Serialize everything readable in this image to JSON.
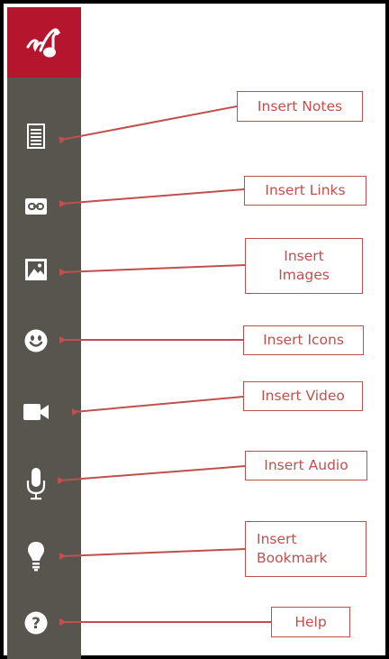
{
  "app": {
    "logo_icon": "music-notes-logo-icon",
    "sidebar_color": "#57554d",
    "logo_color": "#b5162d",
    "callout_color": "#c0504d"
  },
  "tools": [
    {
      "name": "notes",
      "icon": "document-lines-icon",
      "callout": "Insert Notes"
    },
    {
      "name": "links",
      "icon": "chain-link-icon",
      "callout": "Insert Links"
    },
    {
      "name": "images",
      "icon": "picture-icon",
      "callout": "Insert\nImages"
    },
    {
      "name": "icons",
      "icon": "smiley-face-icon",
      "callout": "Insert Icons"
    },
    {
      "name": "video",
      "icon": "video-camera-icon",
      "callout": "Insert Video"
    },
    {
      "name": "audio",
      "icon": "microphone-icon",
      "callout": "Insert Audio"
    },
    {
      "name": "bookmark",
      "icon": "lightbulb-icon",
      "callout": "Insert\nBookmark"
    },
    {
      "name": "help",
      "icon": "question-mark-icon",
      "callout": "Help"
    }
  ]
}
